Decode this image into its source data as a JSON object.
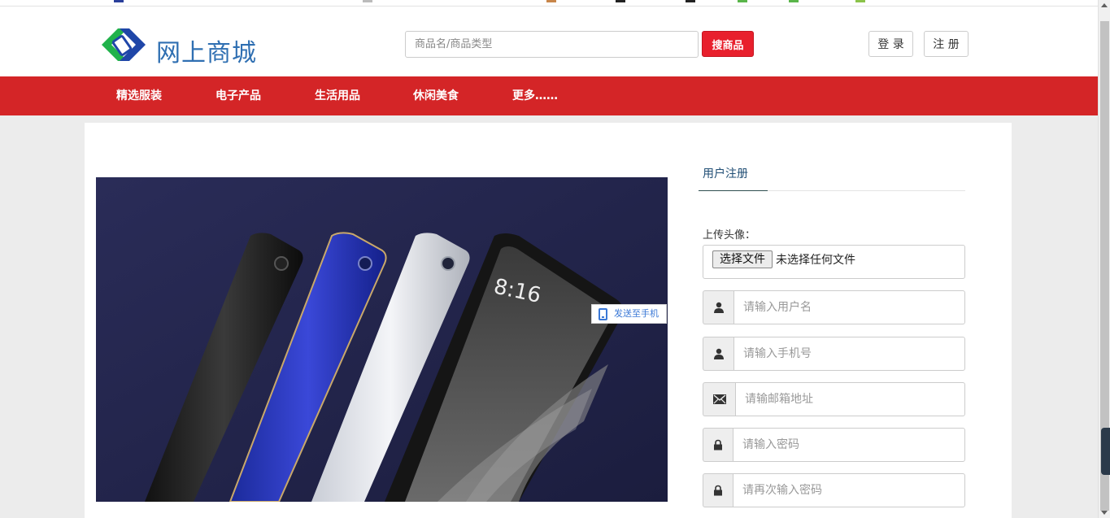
{
  "header": {
    "site_name": "网上商城",
    "search_placeholder": "商品名/商品类型",
    "search_button": "搜商品",
    "login_button": "登 录",
    "register_button": "注 册"
  },
  "nav": {
    "items": [
      "精选服装",
      "电子产品",
      "生活用品",
      "休闲美食",
      "更多……"
    ]
  },
  "banner": {
    "phone_time": "8:16",
    "send_to_phone": "发送至手机"
  },
  "register": {
    "tab_label": "用户注册",
    "upload_label": "上传头像：",
    "file_button": "选择文件",
    "file_status": "未选择任何文件",
    "fields": [
      {
        "icon": "user-icon",
        "placeholder": "请输入用户名"
      },
      {
        "icon": "user-icon",
        "placeholder": "请输入手机号"
      },
      {
        "icon": "envelope-icon",
        "placeholder": "请输邮箱地址"
      },
      {
        "icon": "lock-icon",
        "placeholder": "请输入密码"
      },
      {
        "icon": "lock-icon",
        "placeholder": "请再次输入密码"
      }
    ]
  },
  "colors": {
    "nav_red": "#d42527",
    "search_button_red": "#e8202d",
    "logo_blue": "#2f6fb2",
    "logo_green": "#21b24b"
  }
}
